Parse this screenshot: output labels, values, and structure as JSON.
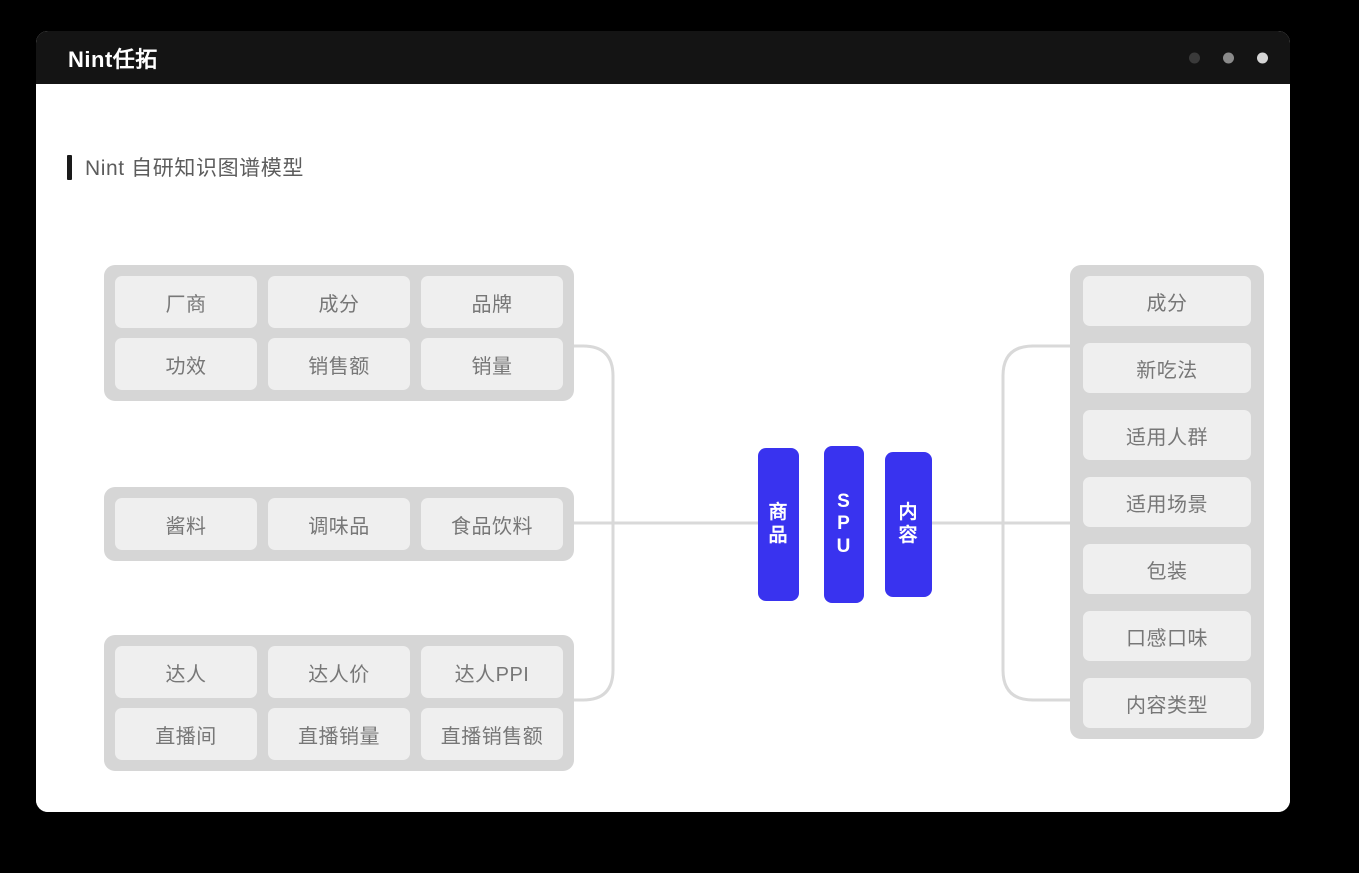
{
  "window": {
    "logo": "Nint任拓",
    "dots": [
      {
        "name": "dot-dark",
        "color": "#3a3a3a"
      },
      {
        "name": "dot-mid",
        "color": "#8a8a8a"
      },
      {
        "name": "dot-light",
        "color": "#d5d5d5"
      }
    ]
  },
  "page": {
    "title": "Nint 自研知识图谱模型"
  },
  "colors": {
    "accent_blue": "#3933ef",
    "group_bg": "#d6d6d6",
    "chip_bg": "#efefef",
    "chip_text": "#777777",
    "connector": "#d9d9d9",
    "titlebar": "#141414"
  },
  "diagram": {
    "left_groups": [
      {
        "name": "product-attributes",
        "rows": [
          [
            "厂商",
            "成分",
            "品牌"
          ],
          [
            "功效",
            "销售额",
            "销量"
          ]
        ]
      },
      {
        "name": "category",
        "rows": [
          [
            "酱料",
            "调味品",
            "食品饮料"
          ]
        ]
      },
      {
        "name": "livestream-kol",
        "rows": [
          [
            "达人",
            "达人价",
            "达人PPI"
          ],
          [
            "直播间",
            "直播销量",
            "直播销售额"
          ]
        ]
      }
    ],
    "center_nodes": [
      {
        "name": "node-product",
        "label": "商品",
        "chars": [
          "商",
          "品"
        ]
      },
      {
        "name": "node-spu",
        "label": "SPU",
        "chars": [
          "S",
          "P",
          "U"
        ]
      },
      {
        "name": "node-content",
        "label": "内容",
        "chars": [
          "内",
          "容"
        ]
      }
    ],
    "right_panel": {
      "name": "content-attributes",
      "items": [
        "成分",
        "新吃法",
        "适用人群",
        "适用场景",
        "包装",
        "口感口味",
        "内容类型"
      ]
    }
  }
}
